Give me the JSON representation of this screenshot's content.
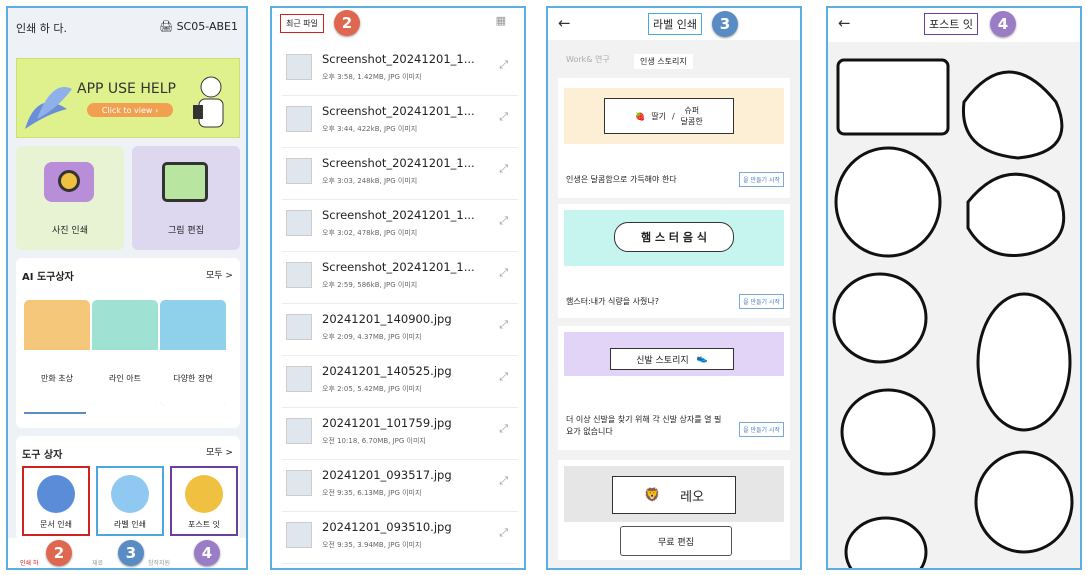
{
  "panel1": {
    "title": "인쇄 하 다.",
    "device": "SC05-ABE1",
    "banner": {
      "title": "APP USE HELP",
      "button": "Click to view ›"
    },
    "photo_print": "사진 인쇄",
    "picture_edit": "그림 편집",
    "ai_toolbox": "AI 도구상자",
    "ai_more": "모두 >",
    "ai_items": [
      "만화 초상",
      "라인 아트",
      "다양한 장면"
    ],
    "toolbox": "도구 상자",
    "toolbox_more": "모두 >",
    "tools": [
      "문서 인쇄",
      "라벨 인쇄",
      "포스트 잇"
    ],
    "nav": [
      "인쇄 하",
      "재료",
      "창작지원"
    ],
    "badges": [
      "2",
      "3",
      "4"
    ],
    "colors": {
      "red_box": "#d02020",
      "blue_box": "#4aa8e0",
      "purple_box": "#6b3fa0"
    }
  },
  "panel2": {
    "tab": "최근 파일",
    "badge": "2",
    "files": [
      {
        "name": "Screenshot_20241201_1...",
        "meta": "오후 3:58, 1.42MB, JPG 이미지"
      },
      {
        "name": "Screenshot_20241201_1...",
        "meta": "오후 3:44, 422kB, JPG 이미지"
      },
      {
        "name": "Screenshot_20241201_1...",
        "meta": "오후 3:03, 248kB, JPG 이미지"
      },
      {
        "name": "Screenshot_20241201_1...",
        "meta": "오후 3:02, 478kB, JPG 이미지"
      },
      {
        "name": "Screenshot_20241201_1...",
        "meta": "오후 2:59, 586kB, JPG 이미지"
      },
      {
        "name": "20241201_140900.jpg",
        "meta": "오후 2:09, 4.37MB, JPG 이미지"
      },
      {
        "name": "20241201_140525.jpg",
        "meta": "오후 2:05, 5.42MB, JPG 이미지"
      },
      {
        "name": "20241201_101759.jpg",
        "meta": "오전 10:18, 6.70MB, JPG 이미지"
      },
      {
        "name": "20241201_093517.jpg",
        "meta": "오전 9:35, 6.13MB, JPG 이미지"
      },
      {
        "name": "20241201_093510.jpg",
        "meta": "오전 9:35, 3.94MB, JPG 이미지"
      }
    ]
  },
  "panel3": {
    "title": "라벨 인쇄",
    "badge": "3",
    "tabs": [
      "Work& 연구",
      "인생 스토리지"
    ],
    "cards": [
      {
        "label_a": "딸기",
        "label_b": "슈퍼",
        "label_c": "달콤한",
        "caption": "인생은 달콤함으로 가득해야 한다",
        "make": "을 만들기 시작"
      },
      {
        "label": "햄 스 터 음 식",
        "caption": "햄스터:내가 식량을 사줬나?",
        "make": "을 만들기 시작"
      },
      {
        "label": "신발 스토리지",
        "caption": "더 이상 신발을 찾기 위해 각 신발 상자를 열 필요가 없습니다",
        "make": "을 만들기 시작"
      },
      {
        "label": "레오"
      }
    ],
    "free_edit": "무료 편집"
  },
  "panel4": {
    "title": "포스트 잇",
    "badge": "4"
  }
}
